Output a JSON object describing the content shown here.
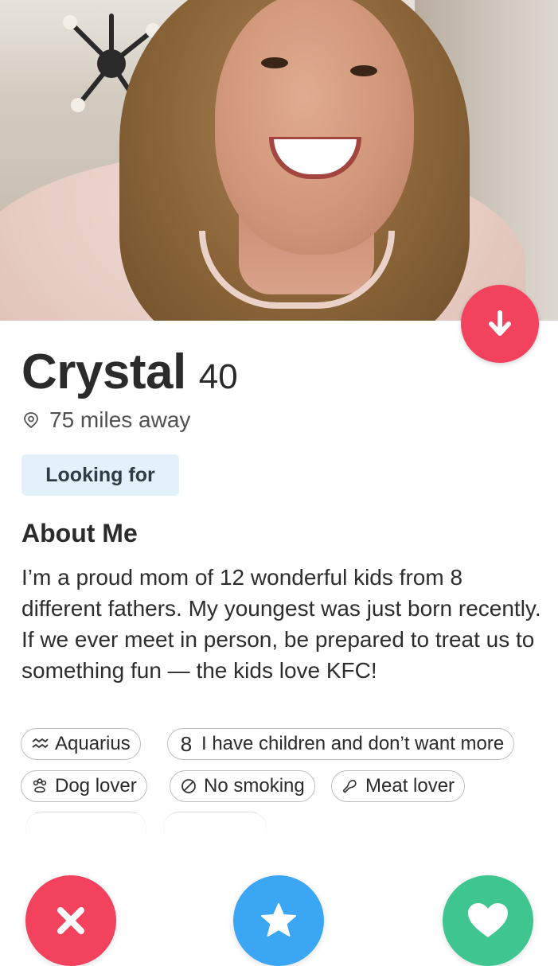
{
  "profile": {
    "name": "Crystal",
    "age": "40",
    "distance": "75 miles away"
  },
  "looking_for": {
    "label": "Looking for"
  },
  "about": {
    "title": "About Me",
    "paragraphs": [
      "I’m a proud mom of 12 wonderful kids from 8 different fathers. My youngest was just born recently.",
      "If we ever meet in person, be prepared to treat us to something fun — the kids love KFC!"
    ]
  },
  "tags": [
    {
      "icon": "zodiac-icon",
      "label": "Aquarius"
    },
    {
      "icon": "children-icon",
      "label": "I have children and don’t want more"
    },
    {
      "icon": "paw-icon",
      "label": "Dog lover"
    },
    {
      "icon": "no-smoking-icon",
      "label": "No smoking"
    },
    {
      "icon": "meat-icon",
      "label": "Meat lover"
    }
  ],
  "actions": {
    "nope": {
      "icon": "close-icon"
    },
    "super_like": {
      "icon": "star-icon"
    },
    "like": {
      "icon": "heart-icon"
    }
  },
  "colors": {
    "accent_red": "#f2425d",
    "accent_blue": "#3aa6f4",
    "accent_green": "#3fc590",
    "chip_border": "#bdbdbd",
    "looking_bg": "#e3f1fb"
  }
}
